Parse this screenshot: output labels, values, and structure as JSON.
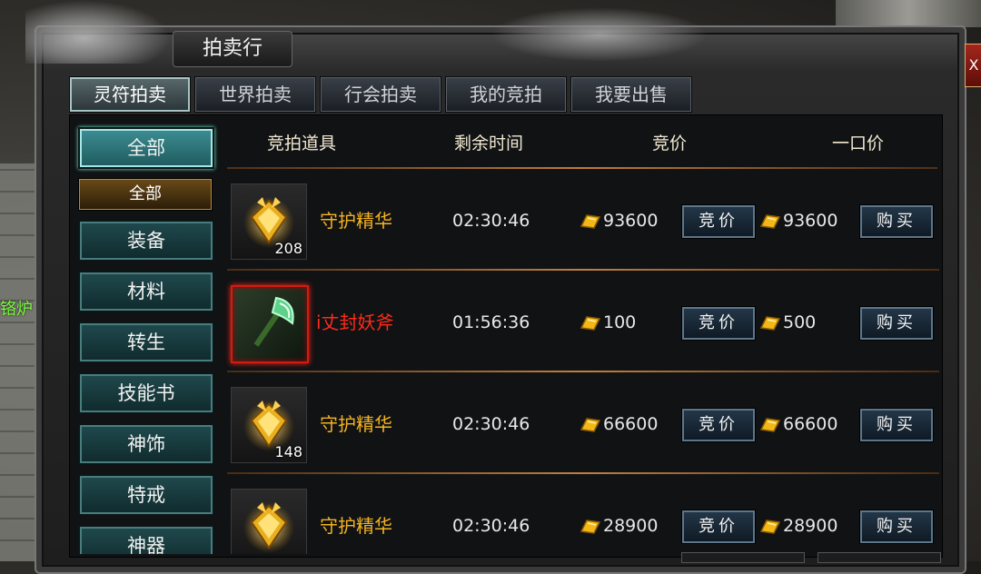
{
  "window": {
    "title": "拍卖行",
    "close_label": "X"
  },
  "tabs": [
    {
      "label": "灵符拍卖",
      "active": true
    },
    {
      "label": "世界拍卖",
      "active": false
    },
    {
      "label": "行会拍卖",
      "active": false
    },
    {
      "label": "我的竞拍",
      "active": false
    },
    {
      "label": "我要出售",
      "active": false
    }
  ],
  "sidebar": {
    "items": [
      {
        "label": "全部",
        "active": true
      },
      {
        "label": "全部",
        "sub": true
      },
      {
        "label": "装备"
      },
      {
        "label": "材料"
      },
      {
        "label": "转生"
      },
      {
        "label": "技能书"
      },
      {
        "label": "神饰"
      },
      {
        "label": "特戒"
      },
      {
        "label": "神器"
      }
    ]
  },
  "table": {
    "headers": {
      "item": "竞拍道具",
      "time": "剩余时间",
      "bid": "竞价",
      "buyout": "一口价"
    },
    "bid_button": "竞价",
    "buy_button": "购买",
    "rows": [
      {
        "name": "守护精华",
        "count": "208",
        "time": "02:30:46",
        "bid": "93600",
        "buyout": "93600",
        "rarity": "gold",
        "icon": "guard-essence-icon"
      },
      {
        "name": "i丈封妖斧",
        "count": "",
        "time": "01:56:36",
        "bid": "100",
        "buyout": "500",
        "rarity": "red",
        "icon": "axe-icon"
      },
      {
        "name": "守护精华",
        "count": "148",
        "time": "02:30:46",
        "bid": "66600",
        "buyout": "66600",
        "rarity": "gold",
        "icon": "guard-essence-icon"
      },
      {
        "name": "守护精华",
        "count": "",
        "time": "02:30:46",
        "bid": "28900",
        "buyout": "28900",
        "rarity": "gold",
        "icon": "guard-essence-icon"
      }
    ]
  },
  "background": {
    "side_text": "铬炉"
  },
  "colors": {
    "gold_text": "#f5b321",
    "red_text": "#ff2a1a",
    "tab_active": "#a7c3c4",
    "category_active": "#3c8e93"
  }
}
